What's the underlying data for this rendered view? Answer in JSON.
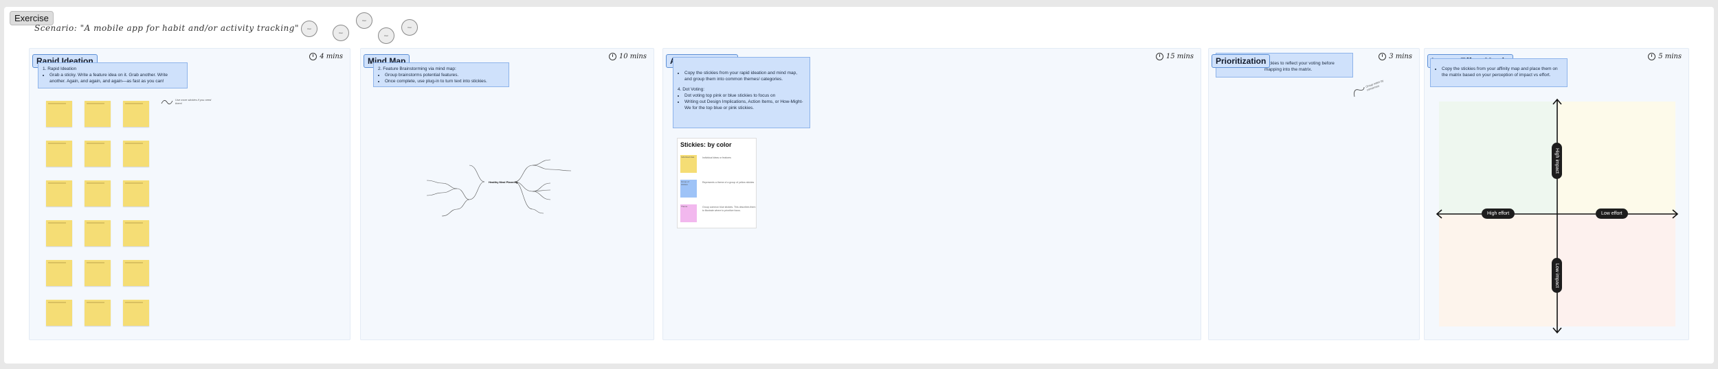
{
  "exercise_label": "Exercise",
  "scenario": "Scenario: \"A mobile app for habit and/or activity tracking\"",
  "avatars": [
    "User",
    "User",
    "User",
    "User",
    "User"
  ],
  "sections": [
    {
      "title": "Rapid Ideation",
      "timer": "4 mins",
      "instructions": {
        "heading": "1. Rapid Ideation",
        "bullets": [
          "Grab a sticky. Write a feature idea on it. Grab another. Write another. Again, and again, and again—as fast as you can!"
        ]
      },
      "note": "Use more stickies if you need them!"
    },
    {
      "title": "Mind Map",
      "timer": "10 mins",
      "instructions": {
        "heading": "2. Feature Brainstorming via mind map:",
        "bullets": [
          "Group brainstorms potential features.",
          "Once complete, use plug-in to turn text into stickies."
        ]
      },
      "center_node": "Healthy Meal Planning"
    },
    {
      "title": "Affinity Diagram",
      "timer": "15 mins",
      "instructions": {
        "bullets_a": [
          "Copy the stickies from your rapid ideation and mind map, and group them into common themes/ categories."
        ],
        "heading_b": "4. Dot Voting:",
        "bullets_b": [
          "Dot voting top pink or blue stickies to focus on",
          "Writing out Design Implications, Action Items, or How-Might-We for the top blue or pink stickies."
        ]
      },
      "legend": {
        "title": "Stickies: by color",
        "rows": [
          {
            "swatch": "Individual idea",
            "desc": "Individual ideas or features",
            "color": "#f5dd75"
          },
          {
            "swatch": "Group of stickies",
            "desc": "Represents a theme of a group of yellow stickies",
            "color": "#9ec3f7"
          },
          {
            "swatch": "Theme",
            "desc": "Group common blue stickies. This describes them to illustrate where to prioritize focus.",
            "color": "#f2b8ee"
          }
        ]
      }
    },
    {
      "title": "Prioritization",
      "timer": "3 mins",
      "instructions": {
        "text": "stickies to reflect your voting before mapping into the matrix."
      },
      "note": "Group notes by consensus"
    },
    {
      "title": "Impact Effort Matrix",
      "timer": "5 mins",
      "instructions": {
        "bullets": [
          "Copy the stickies from your affinity map and place them on the matrix based on your perception of impact vs effort."
        ]
      },
      "axes": {
        "high_impact": "High impact",
        "low_impact": "Low impact",
        "high_effort": "High effort",
        "low_effort": "Low effort"
      }
    }
  ],
  "colors": {
    "sticky_yellow": "#f5dd75",
    "header_blue": "#cfe1fb",
    "section_bg": "#f4f8fd"
  }
}
